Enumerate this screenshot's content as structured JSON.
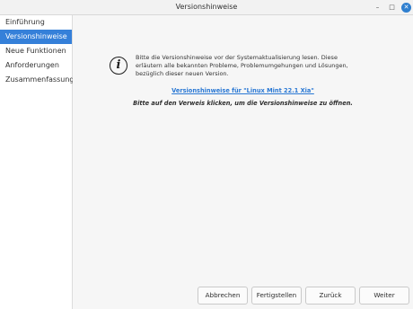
{
  "window": {
    "title": "Versionshinweise",
    "minimize_glyph": "–",
    "maximize_glyph": "□",
    "close_glyph": "✕"
  },
  "sidebar": {
    "items": [
      {
        "label": "Einführung",
        "active": false
      },
      {
        "label": "Versionshinweise",
        "active": true
      },
      {
        "label": "Neue Funktionen",
        "active": false
      },
      {
        "label": "Anforderungen",
        "active": false
      },
      {
        "label": "Zusammenfassung",
        "active": false
      }
    ]
  },
  "main": {
    "icon": {
      "name": "info-icon",
      "glyph": "i"
    },
    "description": "Bitte die Versionshinweise vor der Systemaktualisierung lesen. Diese erläutern alle bekannten Probleme, Problemumgehungen und Lösungen, bezüglich dieser neuen Version.",
    "link_text": "Versionshinweise für \"Linux Mint 22.1 Xia\"",
    "hint_text": "Bitte auf den Verweis klicken, um die Versionshinweise zu öffnen."
  },
  "buttons": {
    "cancel": "Abbrechen",
    "finish": "Fertigstellen",
    "back": "Zurück",
    "next": "Weiter"
  },
  "colors": {
    "accent": "#3580d9",
    "link": "#2a78d4",
    "close_button": "#2f7fcf"
  }
}
